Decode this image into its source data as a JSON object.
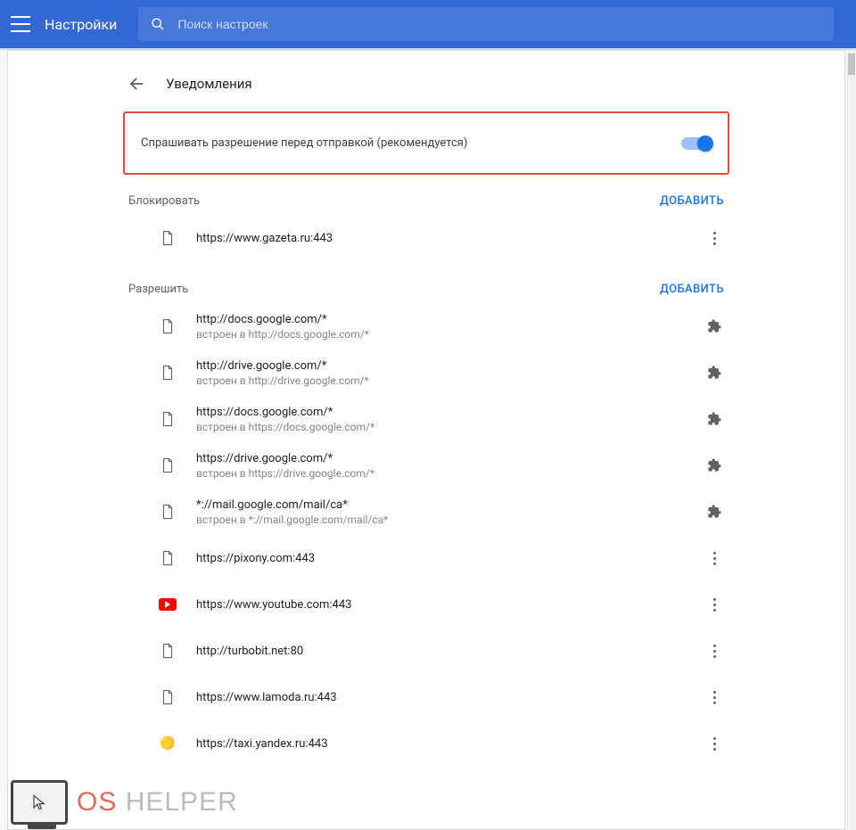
{
  "header": {
    "app_title": "Настройки",
    "search_placeholder": "Поиск настроек"
  },
  "page": {
    "heading": "Уведомления",
    "ask_permission_label": "Спрашивать разрешение перед отправкой (рекомендуется)",
    "ask_permission_on": true
  },
  "block_section": {
    "label": "Блокировать",
    "add_label": "ДОБАВИТЬ",
    "items": [
      {
        "url": "https://www.gazeta.ru:443",
        "sub": "",
        "icon": "page",
        "action": "menu"
      }
    ]
  },
  "allow_section": {
    "label": "Разрешить",
    "add_label": "ДОБАВИТЬ",
    "items": [
      {
        "url": "http://docs.google.com/*",
        "sub": "встроен в http://docs.google.com/*",
        "icon": "page",
        "action": "ext"
      },
      {
        "url": "http://drive.google.com/*",
        "sub": "встроен в http://drive.google.com/*",
        "icon": "page",
        "action": "ext"
      },
      {
        "url": "https://docs.google.com/*",
        "sub": "встроен в https://docs.google.com/*",
        "icon": "page",
        "action": "ext"
      },
      {
        "url": "https://drive.google.com/*",
        "sub": "встроен в https://drive.google.com/*",
        "icon": "page",
        "action": "ext"
      },
      {
        "url": "*://mail.google.com/mail/ca*",
        "sub": "встроен в *://mail.google.com/mail/ca*",
        "icon": "page",
        "action": "ext"
      },
      {
        "url": "https://pixony.com:443",
        "sub": "",
        "icon": "page",
        "action": "menu"
      },
      {
        "url": "https://www.youtube.com:443",
        "sub": "",
        "icon": "youtube",
        "action": "menu"
      },
      {
        "url": "http://turbobit.net:80",
        "sub": "",
        "icon": "page",
        "action": "menu"
      },
      {
        "url": "https://www.lamoda.ru:443",
        "sub": "",
        "icon": "page",
        "action": "menu"
      },
      {
        "url": "https://taxi.yandex.ru:443",
        "sub": "",
        "icon": "yandex",
        "action": "menu"
      }
    ]
  },
  "watermark": {
    "text_os": "OS",
    "text_helper": " HELPER"
  }
}
